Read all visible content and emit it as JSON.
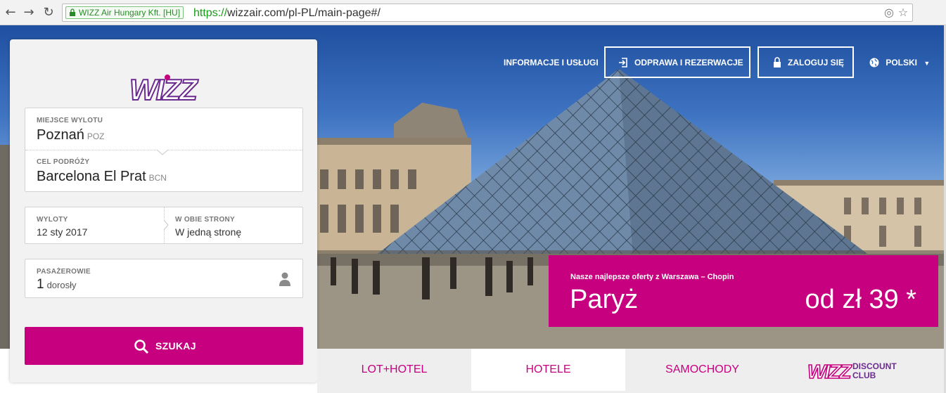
{
  "browser": {
    "ev_label": "WIZZ Air Hungary Kft. [HU]",
    "url_scheme": "https://",
    "url_rest": "wizzair.com/pl-PL/main-page#/"
  },
  "header": {
    "info_link": "INFORMACJE I USŁUGI",
    "checkin_button": "ODPRAWA I REZERWACJE",
    "login_button": "ZALOGUJ SIĘ",
    "language": "POLSKI"
  },
  "logo": {
    "text": "WIZZ"
  },
  "search": {
    "origin_label": "MIEJSCE WYLOTU",
    "origin_value": "Poznań",
    "origin_code": "POZ",
    "destination_label": "CEL PODRÓŻY",
    "destination_value": "Barcelona El Prat",
    "destination_code": "BCN",
    "departure_label": "WYLOTY",
    "departure_value": "12 sty 2017",
    "return_label": "W OBIE STRONY",
    "return_value": "W jedną stronę",
    "passengers_label": "PASAŻEROWIE",
    "passengers_count": "1",
    "passengers_unit": "dorosły",
    "search_button": "SZUKAJ"
  },
  "promo": {
    "subtitle": "Nasze najlepsze oferty z Warszawa – Chopin",
    "city": "Paryż",
    "price": "od zł 39 *"
  },
  "tabs": [
    {
      "label": "LOT+HOTEL"
    },
    {
      "label": "HOTELE"
    },
    {
      "label": "SAMOCHODY"
    }
  ],
  "discount_club": {
    "brand": "WIZZ",
    "line1": "DISCOUNT",
    "line2": "CLUB"
  },
  "colors": {
    "brand": "#c6007e",
    "purple": "#6c2c8f",
    "panel_bg": "#f2f2f2"
  }
}
